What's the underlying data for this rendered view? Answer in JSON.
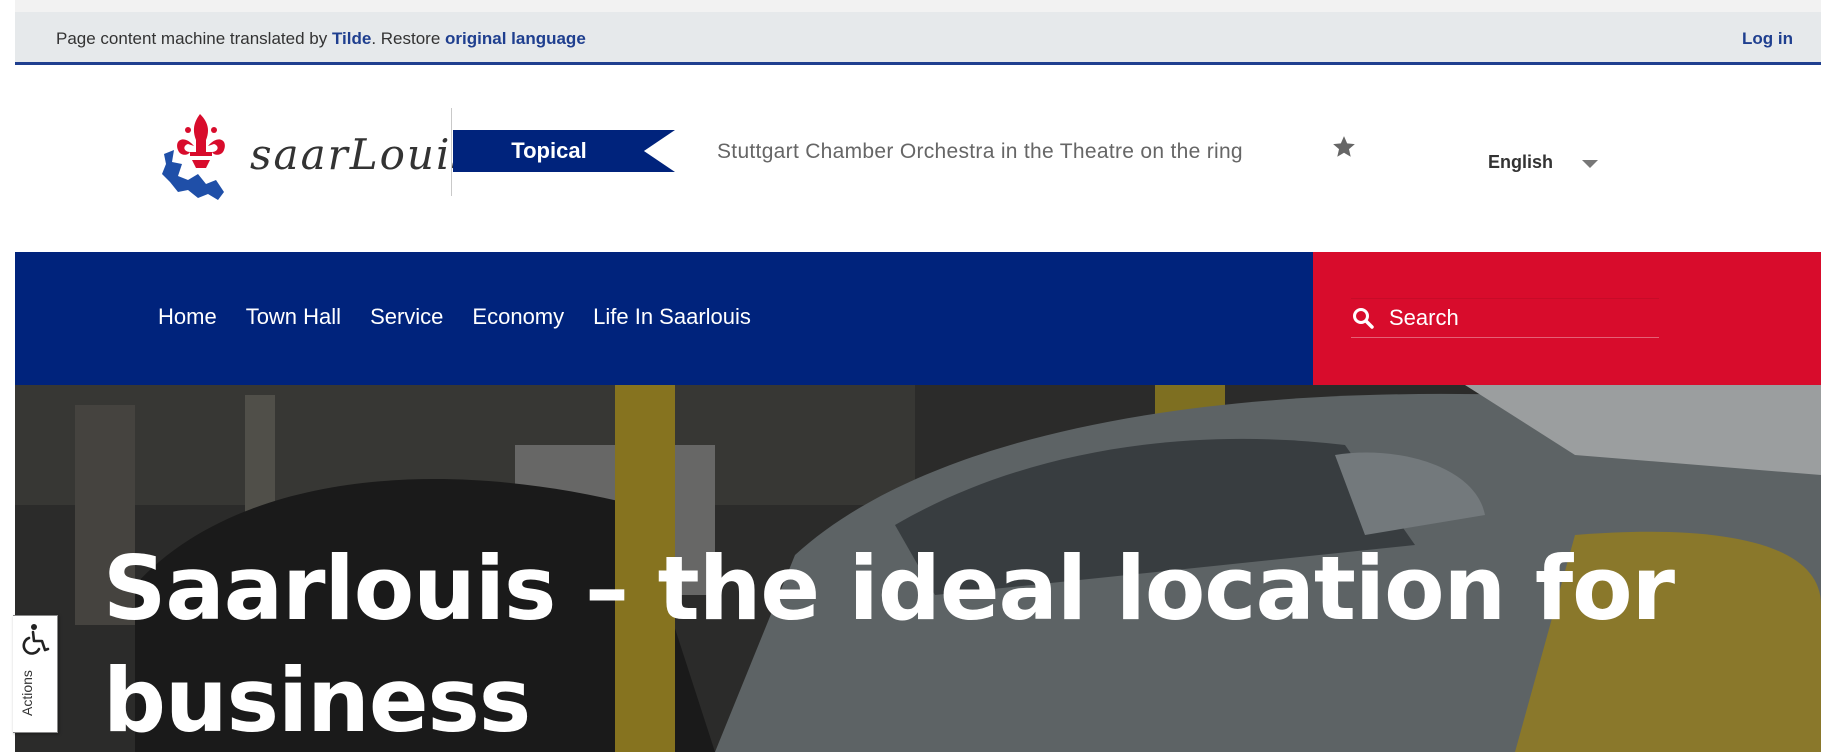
{
  "translation_bar": {
    "prefix": "Page content machine translated by ",
    "provider": "Tilde",
    "middle": ". Restore ",
    "restore_link": "original language",
    "login": "Log in"
  },
  "header": {
    "logo_text": "saarLouis",
    "topical_label": "Topical",
    "ticker_text": "Stuttgart Chamber Orchestra in the Theatre on the ring",
    "favorite_icon": "star-icon",
    "language": "English"
  },
  "nav": {
    "items": [
      "Home",
      "Town Hall",
      "Service",
      "Economy",
      "Life In Saarlouis"
    ]
  },
  "search": {
    "placeholder": "Search",
    "icon": "search-icon"
  },
  "hero": {
    "title": "Saarlouis – the ideal location for business"
  },
  "accessibility": {
    "icon": "wheelchair-icon",
    "label": "Actions"
  },
  "colors": {
    "brand_blue": "#00237c",
    "brand_red": "#d80c2c",
    "link_blue": "#1f3f8f"
  }
}
